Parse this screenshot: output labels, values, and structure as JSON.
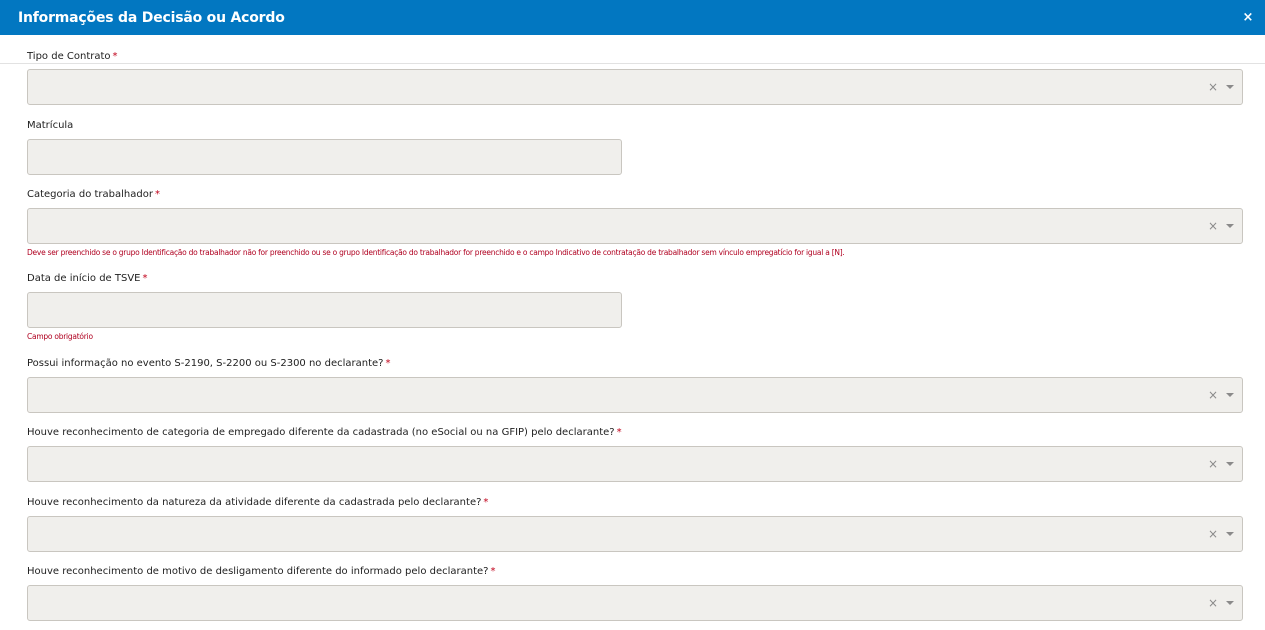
{
  "modal": {
    "title": "Informações da Decisão ou Acordo",
    "close_label": "×"
  },
  "fields": {
    "tipo_contrato": {
      "label": "Tipo de Contrato",
      "required": "*"
    },
    "matricula": {
      "label": "Matrícula"
    },
    "categoria": {
      "label": "Categoria do trabalhador",
      "required": "*",
      "error": "Deve ser preenchido se o grupo Identificação do trabalhador não for preenchido ou se o grupo Identificação do trabalhador for preenchido e o campo Indicativo de contratação de trabalhador sem vínculo empregatício for igual a [N]."
    },
    "data_inicio_tsve": {
      "label": "Data de início de TSVE",
      "required": "*",
      "error": "Campo obrigatório"
    },
    "possui_informacao": {
      "label": "Possui informação no evento S-2190, S-2200 ou S-2300 no declarante?",
      "required": "*"
    },
    "reconhecimento_categoria": {
      "label": "Houve reconhecimento de categoria de empregado diferente da cadastrada (no eSocial ou na GFIP) pelo declarante?",
      "required": "*"
    },
    "reconhecimento_natureza": {
      "label": "Houve reconhecimento da natureza da atividade diferente da cadastrada pelo declarante?",
      "required": "*"
    },
    "reconhecimento_desligamento": {
      "label": "Houve reconhecimento de motivo de desligamento diferente do informado pelo declarante?",
      "required": "*"
    }
  },
  "select_controls": {
    "clear": "×"
  }
}
